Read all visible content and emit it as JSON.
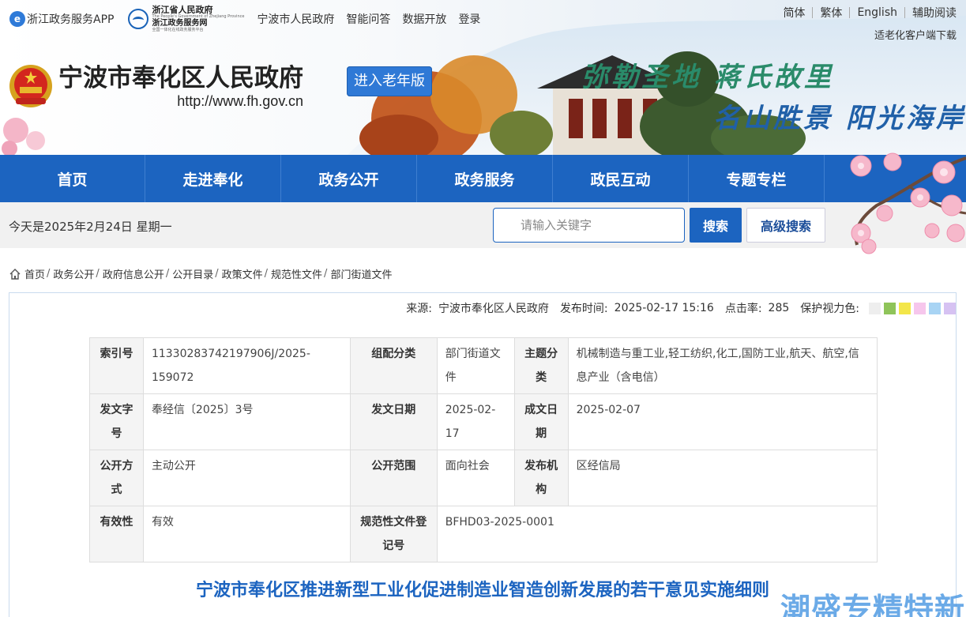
{
  "topbar": {
    "app_link": "浙江政务服务APP",
    "zj_logo": {
      "line1": "浙江省人民政府",
      "line2": "The People's Government of Zhejiang Province",
      "line3": "浙江政务服务网",
      "line4": "全国一体化在线政务服务平台"
    },
    "links": [
      "宁波市人民政府",
      "智能问答",
      "数据开放",
      "登录"
    ],
    "languages": [
      "简体",
      "繁体",
      "English",
      "辅助阅读"
    ],
    "elder_download": "适老化客户端下载"
  },
  "brand": {
    "title": "宁波市奉化区人民政府",
    "url": "http://www.fh.gov.cn",
    "elder_mode_button": "进入老年版",
    "slogan_line1": "弥勒圣地 蒋氏故里",
    "slogan_line2": "名山胜景 阳光海岸"
  },
  "nav": {
    "items": [
      "首页",
      "走进奉化",
      "政务公开",
      "政务服务",
      "政民互动",
      "专题专栏"
    ]
  },
  "inforow": {
    "date_text": "今天是2025年2月24日  星期一",
    "search_placeholder": "请输入关键字",
    "search_button": "搜索",
    "advanced_search_button": "高级搜索"
  },
  "breadcrumb": [
    "首页",
    "政务公开",
    "政府信息公开",
    "公开目录",
    "政策文件",
    "规范性文件",
    "部门街道文件"
  ],
  "meta": {
    "source_label": "来源:",
    "source_value": "宁波市奉化区人民政府",
    "time_label": "发布时间:",
    "time_value": "2025-02-17 15:16",
    "clicks_label": "点击率:",
    "clicks_value": "285",
    "eye_color_label": "保护视力色:",
    "eye_colors": [
      "#eeeeee",
      "#8fc45a",
      "#f3e64a",
      "#f6c6ec",
      "#a8d4f4",
      "#d6c2f2"
    ]
  },
  "info_table": {
    "index_no_label": "索引号",
    "index_no_value": "11330283742197906J/2025-159072",
    "category_label": "组配分类",
    "category_value": "部门街道文件",
    "topic_label": "主题分类",
    "topic_value": "机械制造与重工业,轻工纺织,化工,国防工业,航天、航空,信息产业（含电信）",
    "doc_no_label": "发文字号",
    "doc_no_value": "奉经信〔2025〕3号",
    "issue_date_label": "发文日期",
    "issue_date_value": "2025-02-17",
    "made_date_label": "成文日期",
    "made_date_value": "2025-02-07",
    "open_mode_label": "公开方式",
    "open_mode_value": "主动公开",
    "open_scope_label": "公开范围",
    "open_scope_value": "面向社会",
    "publisher_label": "发布机构",
    "publisher_value": "区经信局",
    "validity_label": "有效性",
    "validity_value": "有效",
    "reg_no_label": "规范性文件登记号",
    "reg_no_value": "BFHD03-2025-0001"
  },
  "doc_title": "宁波市奉化区推进新型工业化促进制造业智造创新发展的若干意见实施细则",
  "watermark": "潮盛专精特新"
}
